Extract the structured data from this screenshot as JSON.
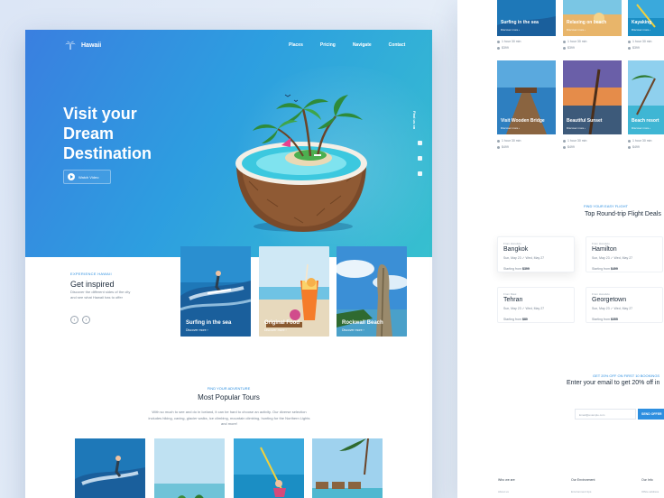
{
  "brand": {
    "name": "Hawaii"
  },
  "nav": [
    "Places",
    "Pricing",
    "Navigate",
    "Contact"
  ],
  "hero": {
    "title_lines": [
      "Visit your",
      "Dream",
      "Destination"
    ],
    "watch_label": "Watch Video",
    "find_us": "Find us on"
  },
  "inspired": {
    "kicker": "EXPERIENCE HAWAII",
    "title": "Get inspired",
    "text": "Discover the different sides of the city and see what Hawaii has to offer",
    "prev_icon": "arrow-left-icon",
    "next_icon": "arrow-right-icon"
  },
  "experience_cards": [
    {
      "title": "Surfing in the sea",
      "more": "Discover more ›"
    },
    {
      "title": "Original Food",
      "more": "Discover more ›"
    },
    {
      "title": "Rockwall Beach",
      "more": "Discover more ›"
    }
  ],
  "tours": {
    "kicker": "FIND YOUR ADVENTURE",
    "title": "Most Popular Tours",
    "text": "With so much to see and do in Iceland, it can be hard to choose an activity. Our diverse selection includes hiking, caving, glacier walks, ice climbing, mountain climbing, hunting for the Northern Lights and more!"
  },
  "right_tours_top": [
    {
      "title": "Surfing in the sea",
      "more": "Discover more ›",
      "duration": "1 hour 30 min",
      "price": "$399"
    },
    {
      "title": "Relaxing on beach",
      "more": "Discover more ›",
      "duration": "1 hour 30 min",
      "price": "$399"
    },
    {
      "title": "Kayaking",
      "more": "Discover more ›",
      "duration": "1 hour 30 min",
      "price": "$399"
    }
  ],
  "right_tours_bottom": [
    {
      "title": "Visit Wooden Bridge",
      "more": "Discover more ›",
      "duration": "1 hour 30 min",
      "price": "$499"
    },
    {
      "title": "Beautiful Sunset",
      "more": "Discover more ›",
      "duration": "1 hour 30 min",
      "price": "$499"
    },
    {
      "title": "Beach resort",
      "more": "Discover more ›",
      "duration": "1 hour 30 min",
      "price": "$499"
    }
  ],
  "flights": {
    "kicker": "FIND YOUR EASY FLIGHT",
    "title": "Top Round-trip Flight Deals",
    "items": [
      {
        "from": "From Honolulu",
        "city": "Bangkok",
        "dates": "Sun, May 23  ✓  Wed, May 27",
        "price_label": "Starting from",
        "price": "$399"
      },
      {
        "from": "From Honolulu",
        "city": "Hamilton",
        "dates": "Sun, May 23  ✓  Wed, May 27",
        "price_label": "Starting from",
        "price": "$499"
      },
      {
        "from": "From Maui",
        "city": "Tehran",
        "dates": "Sun, May 23  ✓  Wed, May 27",
        "price_label": "Starting from",
        "price": "$80"
      },
      {
        "from": "From Honolulu",
        "city": "Georgetown",
        "dates": "Sun, May 23  ✓  Wed, May 27",
        "price_label": "Starting from",
        "price": "$355"
      }
    ]
  },
  "signup": {
    "kicker": "GET 20% OFF ON FIRST 10 BOOKINGS",
    "title": "Enter your email to get 20% off in",
    "placeholder": "Email@example.com",
    "button": "SEND OFFER"
  },
  "footer": [
    {
      "heading": "Who we are",
      "sub": "About us"
    },
    {
      "heading": "Our Environment",
      "sub": "Environment tips"
    },
    {
      "heading": "Our Info",
      "sub": "Office address"
    }
  ],
  "colors": {
    "accent": "#2d8fe0",
    "hero_start": "#3a7fe0",
    "hero_end": "#37c0cf",
    "text_dark": "#1c2a3a"
  }
}
